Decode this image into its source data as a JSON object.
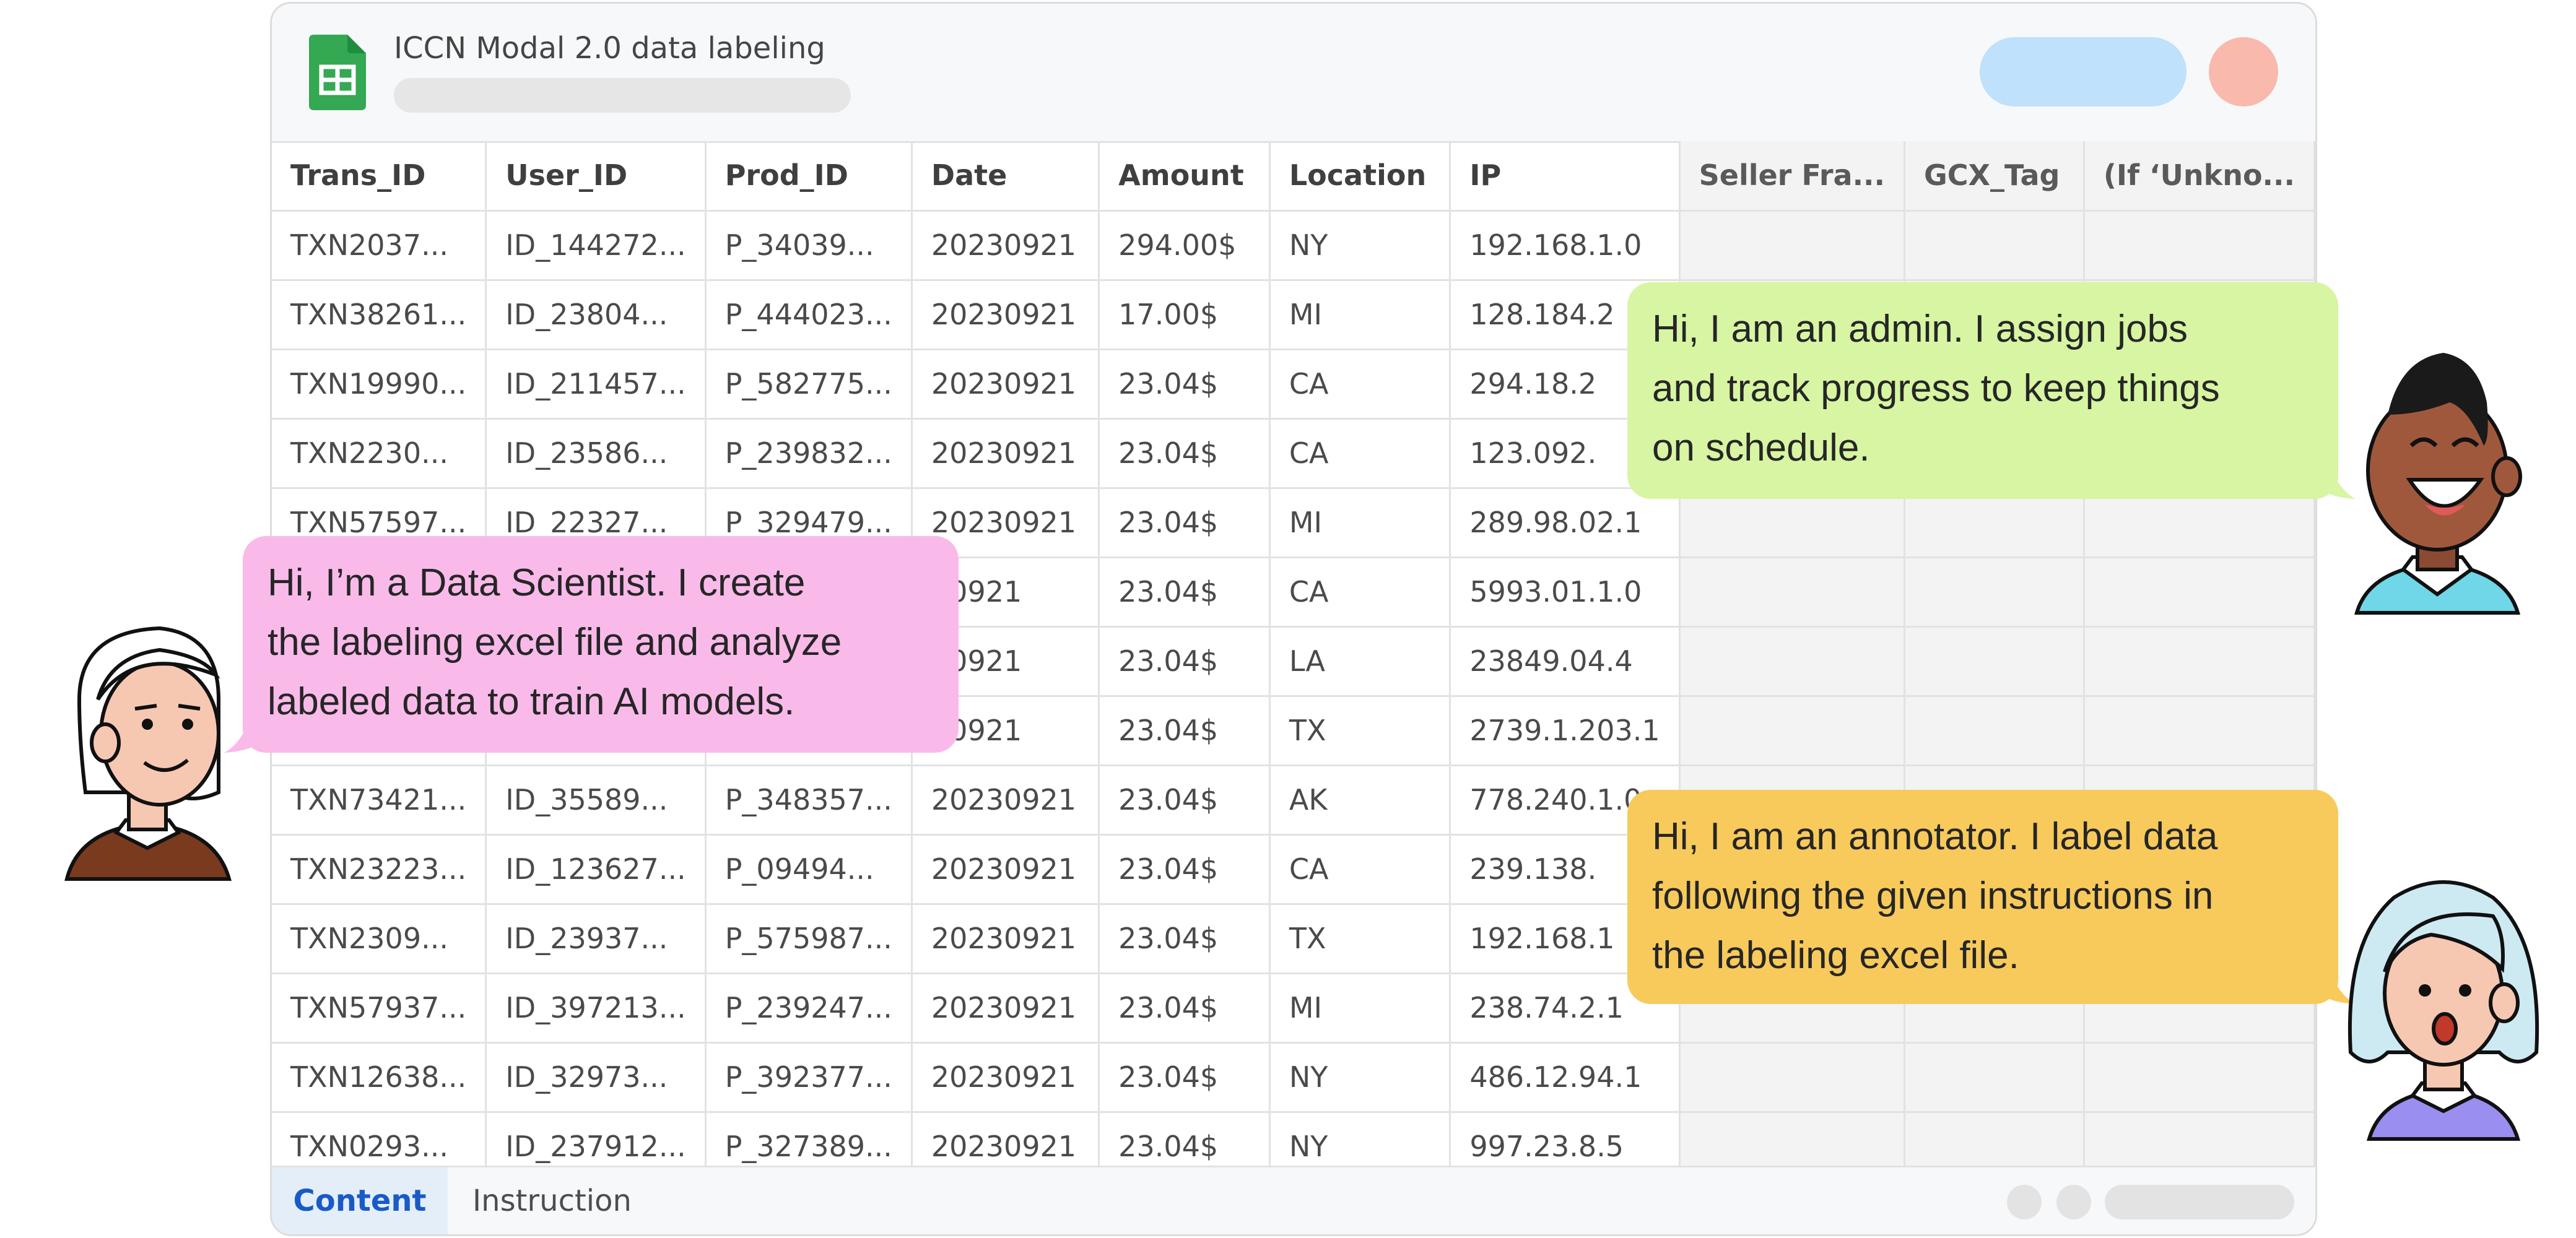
{
  "window": {
    "title": "ICCN Modal 2.0 data labeling",
    "icon": "google-sheets-icon",
    "colors": {
      "accent": "#1a5ac7",
      "sheets_green": "#34a853",
      "pill_blue": "#bfe1fb",
      "avatar_salmon": "#f9b9ad"
    }
  },
  "table": {
    "columns": [
      "Trans_ID",
      "User_ID",
      "Prod_ID",
      "Date",
      "Amount",
      "Location",
      "IP",
      "Seller Fra...",
      "GCX_Tag",
      "(If ‘Unkno..."
    ],
    "rows": [
      [
        "TXN2037...",
        "ID_144272...",
        "P_34039...",
        "20230921",
        "294.00$",
        "NY",
        "192.168.1.0",
        "",
        "",
        ""
      ],
      [
        "TXN38261...",
        "ID_23804...",
        "P_444023...",
        "20230921",
        "17.00$",
        "MI",
        "128.184.2",
        "",
        "",
        ""
      ],
      [
        "TXN19990...",
        "ID_211457...",
        "P_582775...",
        "20230921",
        "23.04$",
        "CA",
        "294.18.2",
        "",
        "",
        ""
      ],
      [
        "TXN2230...",
        "ID_23586...",
        "P_239832...",
        "20230921",
        "23.04$",
        "CA",
        "123.092.",
        "",
        "",
        ""
      ],
      [
        "TXN57597...",
        "ID_22327...",
        "P_329479...",
        "20230921",
        "23.04$",
        "MI",
        "289.98.02.1",
        "",
        "",
        ""
      ],
      [
        "",
        "",
        "",
        "30921",
        "23.04$",
        "CA",
        "5993.01.1.0",
        "",
        "",
        ""
      ],
      [
        "",
        "",
        "",
        "30921",
        "23.04$",
        "LA",
        "23849.04.4",
        "",
        "",
        ""
      ],
      [
        "",
        "",
        "",
        "30921",
        "23.04$",
        "TX",
        "2739.1.203.1",
        "",
        "",
        ""
      ],
      [
        "TXN73421...",
        "ID_35589...",
        "P_348357...",
        "20230921",
        "23.04$",
        "AK",
        "778.240.1.0",
        "",
        "",
        ""
      ],
      [
        "TXN23223...",
        "ID_123627...",
        "P_09494...",
        "20230921",
        "23.04$",
        "CA",
        "239.138.",
        "",
        "",
        ""
      ],
      [
        "TXN2309...",
        "ID_23937...",
        "P_575987...",
        "20230921",
        "23.04$",
        "TX",
        "192.168.1",
        "",
        "",
        ""
      ],
      [
        "TXN57937...",
        "ID_397213...",
        "P_239247...",
        "20230921",
        "23.04$",
        "MI",
        "238.74.2.1",
        "",
        "",
        ""
      ],
      [
        "TXN12638...",
        "ID_32973...",
        "P_392377...",
        "20230921",
        "23.04$",
        "NY",
        "486.12.94.1",
        "",
        "",
        ""
      ],
      [
        "TXN0293...",
        "ID_237912...",
        "P_327389...",
        "20230921",
        "23.04$",
        "NY",
        "997.23.8.5",
        "",
        "",
        ""
      ]
    ]
  },
  "tabs": [
    {
      "label": "Content",
      "active": true
    },
    {
      "label": "Instruction",
      "active": false
    }
  ],
  "bubbles": {
    "admin": {
      "lines": [
        "Hi, I am an admin. I assign jobs",
        "and track progress to keep things",
        "on schedule."
      ],
      "color": "#d7f5a2"
    },
    "data_scientist": {
      "lines": [
        "Hi, I’m a Data Scientist. I create",
        "the labeling excel file and analyze",
        "labeled data to train AI models."
      ],
      "color": "#f9baea"
    },
    "annotator": {
      "lines": [
        "Hi, I am an annotator. I label data",
        "following the given instructions in",
        "the labeling excel file."
      ],
      "color": "#f8ca5b"
    }
  },
  "characters": {
    "admin": "laughing-man-illustration",
    "data_scientist": "smiling-woman-illustration",
    "annotator": "surprised-woman-illustration"
  }
}
